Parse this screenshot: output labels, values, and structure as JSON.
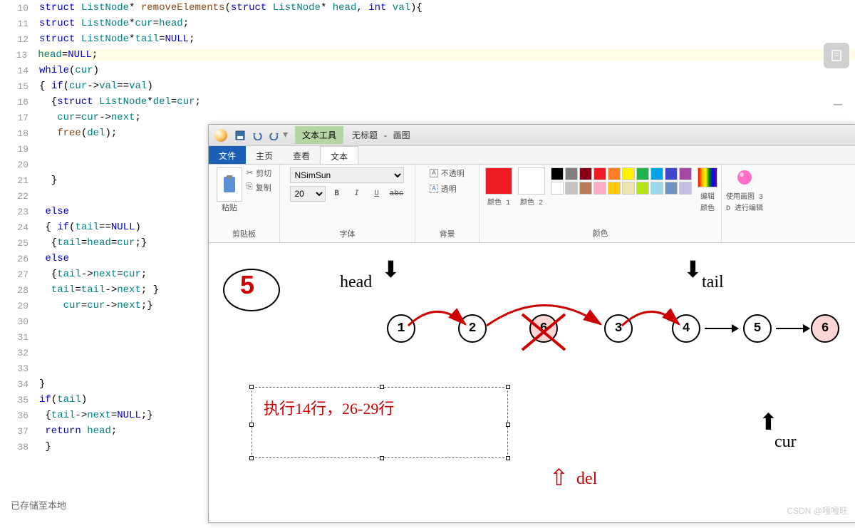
{
  "code": {
    "lines": [
      {
        "n": "10",
        "html": "<span class='kw'>struct</span> <span class='id'>ListNode</span>* <span class='fn'>removeElements</span>(<span class='kw'>struct</span> <span class='id'>ListNode</span>* <span class='id'>head</span>, <span class='kw'>int</span> <span class='id'>val</span>){"
      },
      {
        "n": "11",
        "html": "<span class='kw'>struct</span> <span class='id'>ListNode</span>*<span class='id'>cur</span>=<span class='id'>head</span>;"
      },
      {
        "n": "12",
        "html": "<span class='kw'>struct</span> <span class='id'>ListNode</span>*<span class='id'>tail</span>=<span class='kw'>NULL</span>;"
      },
      {
        "n": "13",
        "html": "<span class='id'>head</span>=<span class='kw'>NULL</span>;",
        "hl": true
      },
      {
        "n": "14",
        "html": "<span class='kw'>while</span>(<span class='id'>cur</span>)"
      },
      {
        "n": "15",
        "html": "{ <span class='kw'>if</span>(<span class='id'>cur</span>-><span class='id'>val</span>==<span class='id'>val</span>)"
      },
      {
        "n": "16",
        "html": "  {<span class='kw'>struct</span> <span class='id'>ListNode</span>*<span class='id'>del</span>=<span class='id'>cur</span>;"
      },
      {
        "n": "17",
        "html": "   <span class='id'>cur</span>=<span class='id'>cur</span>-><span class='id'>next</span>;"
      },
      {
        "n": "18",
        "html": "   <span class='fn'>free</span>(<span class='id'>del</span>);"
      },
      {
        "n": "19",
        "html": ""
      },
      {
        "n": "20",
        "html": ""
      },
      {
        "n": "21",
        "html": "  }"
      },
      {
        "n": "22",
        "html": ""
      },
      {
        "n": "23",
        "html": " <span class='kw'>else</span>"
      },
      {
        "n": "24",
        "html": " { <span class='kw'>if</span>(<span class='id'>tail</span>==<span class='kw'>NULL</span>)"
      },
      {
        "n": "25",
        "html": "  {<span class='id'>tail</span>=<span class='id'>head</span>=<span class='id'>cur</span>;}"
      },
      {
        "n": "26",
        "html": " <span class='kw'>else</span>"
      },
      {
        "n": "27",
        "html": "  {<span class='id'>tail</span>-><span class='id'>next</span>=<span class='id'>cur</span>;"
      },
      {
        "n": "28",
        "html": "  <span class='id'>tail</span>=<span class='id'>tail</span>-><span class='id'>next</span>; }"
      },
      {
        "n": "29",
        "html": "    <span class='id'>cur</span>=<span class='id'>cur</span>-><span class='id'>next</span>;}"
      },
      {
        "n": "30",
        "html": ""
      },
      {
        "n": "31",
        "html": ""
      },
      {
        "n": "32",
        "html": ""
      },
      {
        "n": "33",
        "html": ""
      },
      {
        "n": "34",
        "html": "}"
      },
      {
        "n": "35",
        "html": "<span class='kw'>if</span>(<span class='id'>tail</span>)"
      },
      {
        "n": "36",
        "html": " {<span class='id'>tail</span>-><span class='id'>next</span>=<span class='kw'>NULL</span>;}"
      },
      {
        "n": "37",
        "html": " <span class='kw'>return</span> <span class='id'>head</span>;"
      },
      {
        "n": "38",
        "html": " }"
      }
    ]
  },
  "paint": {
    "tool_tab": "文本工具",
    "title": "无标题 - 画图",
    "menu": {
      "file": "文件",
      "home": "主页",
      "view": "查看",
      "text": "文本"
    },
    "ribbon": {
      "clipboard": {
        "paste": "粘贴",
        "cut": "剪切",
        "copy": "复制",
        "label": "剪贴板"
      },
      "font": {
        "name": "NSimSun",
        "size": "20",
        "label": "字体"
      },
      "bg": {
        "opaque": "不透明",
        "transparent": "透明",
        "label": "背景"
      },
      "colors": {
        "color1": "颜色 1",
        "color2": "颜色 2",
        "label": "颜色",
        "edit": "编辑\n颜色",
        "use": "使用画图 3\nD 进行编辑",
        "swatches_row1": [
          "#000000",
          "#7f7f7f",
          "#880015",
          "#ed1c24",
          "#ff7f27",
          "#fff200",
          "#22b14c",
          "#00a2e8",
          "#3f48cc",
          "#a349a4"
        ],
        "swatches_row2": [
          "#ffffff",
          "#c3c3c3",
          "#b97a57",
          "#ffaec9",
          "#ffc90e",
          "#efe4b0",
          "#b5e61d",
          "#99d9ea",
          "#7092be",
          "#c8bfe7"
        ]
      }
    },
    "canvas": {
      "nodes": [
        "1",
        "2",
        "6",
        "3",
        "4",
        "5",
        "6"
      ],
      "head_label": "head",
      "tail_label": "tail",
      "cur_label": "cur",
      "del_label": "del",
      "textbox": "执行14行，26-29行",
      "step_num": "5"
    }
  },
  "status": "已存储至本地",
  "watermark": "CSDN @嘎嘎旺"
}
